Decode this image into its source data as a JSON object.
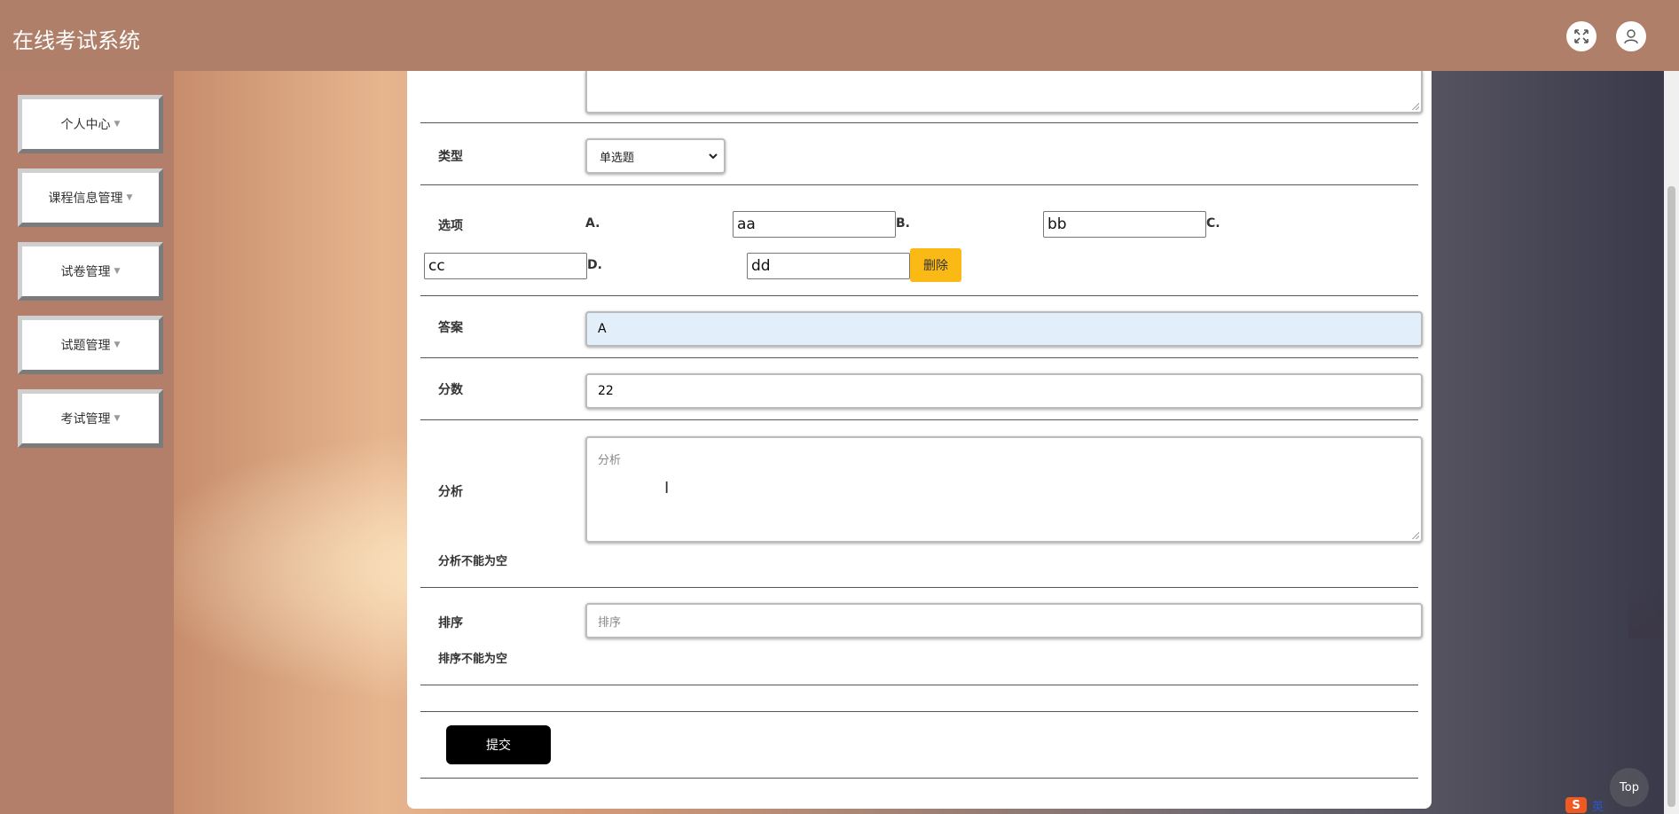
{
  "header": {
    "title": "在线考试系统"
  },
  "sidebar": {
    "items": [
      {
        "label": "个人中心"
      },
      {
        "label": "课程信息管理"
      },
      {
        "label": "试卷管理"
      },
      {
        "label": "试题管理"
      },
      {
        "label": "考试管理"
      }
    ],
    "caret": "▼"
  },
  "form": {
    "type": {
      "label": "类型",
      "value": "单选题"
    },
    "options": {
      "label": "选项",
      "items": [
        {
          "letter": "A.",
          "value": "aa"
        },
        {
          "letter": "B.",
          "value": "bb"
        },
        {
          "letter": "C.",
          "value": "cc"
        },
        {
          "letter": "D.",
          "value": "dd"
        }
      ],
      "delete_label": "删除"
    },
    "answer": {
      "label": "答案",
      "value": "A"
    },
    "score": {
      "label": "分数",
      "value": "22"
    },
    "analysis": {
      "label": "分析",
      "placeholder": "分析",
      "error": "分析不能为空"
    },
    "sort": {
      "label": "排序",
      "placeholder": "排序",
      "error": "排序不能为空"
    },
    "submit_label": "提交"
  },
  "top_button": "Top",
  "ime": {
    "logo": "S",
    "mode": "英"
  },
  "colors": {
    "header": "#b07f6a",
    "sidebar": "#b47f6a",
    "delete_button": "#fbb915",
    "submit_button": "#000000",
    "answer_highlight": "#e3eefb"
  }
}
